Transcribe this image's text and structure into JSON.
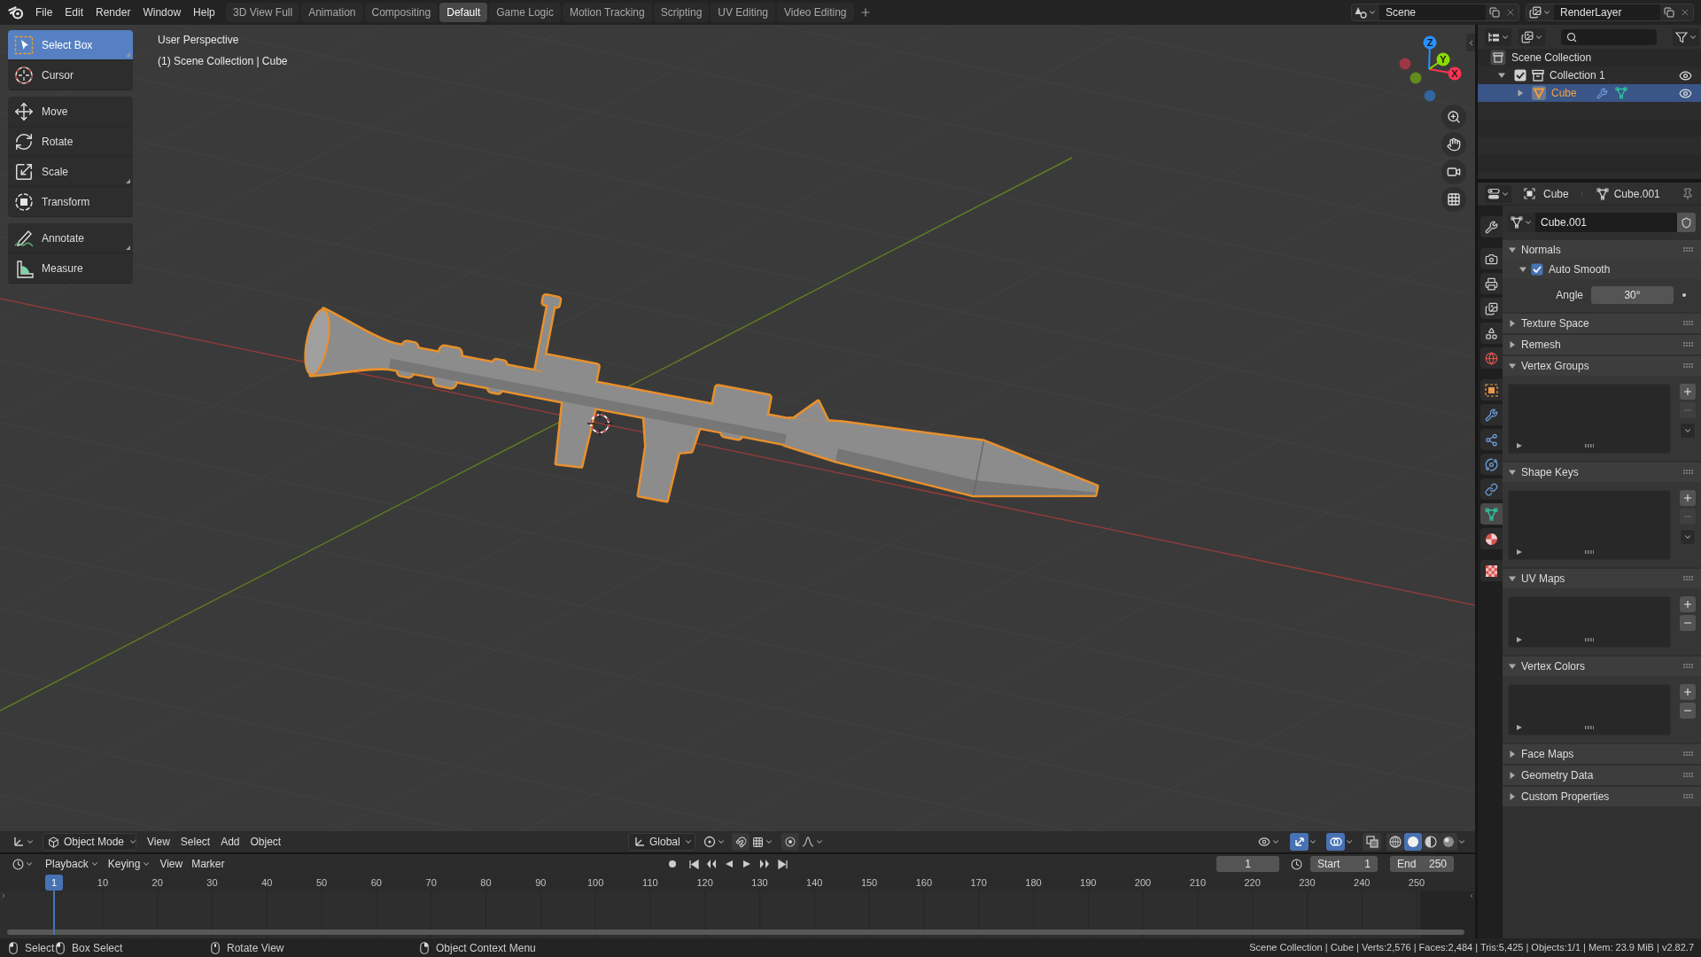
{
  "top_bar": {
    "menus": [
      "File",
      "Edit",
      "Render",
      "Window",
      "Help"
    ],
    "workspaces": [
      {
        "label": "3D View Full",
        "selected": false
      },
      {
        "label": "Animation",
        "selected": false
      },
      {
        "label": "Compositing",
        "selected": false
      },
      {
        "label": "Default",
        "selected": true
      },
      {
        "label": "Game Logic",
        "selected": false
      },
      {
        "label": "Motion Tracking",
        "selected": false
      },
      {
        "label": "Scripting",
        "selected": false
      },
      {
        "label": "UV Editing",
        "selected": false
      },
      {
        "label": "Video Editing",
        "selected": false
      }
    ],
    "scene": "Scene",
    "view_layer": "RenderLayer"
  },
  "toolbar": [
    [
      {
        "label": "Select Box",
        "selected": true,
        "flyout": true
      },
      {
        "label": "Cursor",
        "selected": false,
        "flyout": false
      }
    ],
    [
      {
        "label": "Move",
        "selected": false,
        "flyout": false
      },
      {
        "label": "Rotate",
        "selected": false,
        "flyout": false
      },
      {
        "label": "Scale",
        "selected": false,
        "flyout": true
      },
      {
        "label": "Transform",
        "selected": false,
        "flyout": false
      }
    ],
    [
      {
        "label": "Annotate",
        "selected": false,
        "flyout": true
      },
      {
        "label": "Measure",
        "selected": false,
        "flyout": false
      }
    ]
  ],
  "viewport": {
    "info": [
      "User Perspective",
      "(1) Scene Collection | Cube"
    ],
    "axes": [
      {
        "label": "X",
        "color": "#ff3352"
      },
      {
        "label": "Y",
        "color": "#8bdc00"
      },
      {
        "label": "Z",
        "color": "#2890ff"
      }
    ],
    "header": {
      "mode": "Object Mode",
      "menus": [
        "View",
        "Select",
        "Add",
        "Object"
      ],
      "orientation": "Global",
      "gizmos": true,
      "overlays": true,
      "xray": false,
      "shading": [
        {
          "selected": false
        },
        {
          "selected": true
        },
        {
          "selected": false
        },
        {
          "selected": false
        }
      ]
    }
  },
  "timeline": {
    "menus": [
      {
        "label": "Playback",
        "dropdown": true
      },
      {
        "label": "Keying",
        "dropdown": true
      },
      {
        "label": "View",
        "dropdown": false
      },
      {
        "label": "Marker",
        "dropdown": false
      }
    ],
    "current_frame": "1",
    "start": {
      "label": "Start",
      "value": "1"
    },
    "end": {
      "label": "End",
      "value": "250"
    },
    "playhead": "1",
    "ruler": [
      "10",
      "20",
      "30",
      "40",
      "50",
      "60",
      "70",
      "80",
      "90",
      "100",
      "110",
      "120",
      "130",
      "140",
      "150",
      "160",
      "170",
      "180",
      "190",
      "200",
      "210",
      "220",
      "230",
      "240",
      "250"
    ]
  },
  "outliner": {
    "tree": [
      {
        "kind": "scene_collection",
        "label": "Scene Collection",
        "selected": false,
        "children": [
          {
            "kind": "collection",
            "label": "Collection 1",
            "selected": false,
            "expanded": true,
            "checked": true,
            "visible": true,
            "children": [
              {
                "kind": "object",
                "label": "Cube",
                "selected": true,
                "expanded": false,
                "visible": true
              }
            ]
          }
        ]
      }
    ]
  },
  "properties": {
    "breadcrumb": [
      "Cube",
      "Cube.001"
    ],
    "tabs": [
      [
        {
          "selected": false
        }
      ],
      [
        {
          "selected": false
        },
        {
          "selected": false
        },
        {
          "selected": false
        },
        {
          "selected": false
        },
        {
          "selected": false
        }
      ],
      [
        {
          "selected": false
        },
        {
          "selected": false
        },
        {
          "selected": false
        },
        {
          "selected": false
        },
        {
          "selected": false
        },
        {
          "selected": true
        },
        {
          "selected": false
        }
      ],
      [
        {
          "selected": false
        }
      ]
    ],
    "mesh_name": "Cube.001",
    "panels": [
      {
        "kind": "normals",
        "title": "Normals",
        "expanded": true,
        "auto_smooth": {
          "label": "Auto Smooth",
          "checked": true,
          "expanded": true
        },
        "angle": {
          "label": "Angle",
          "value": "30°"
        }
      },
      {
        "kind": "plain",
        "title": "Texture Space",
        "expanded": false
      },
      {
        "kind": "plain",
        "title": "Remesh",
        "expanded": false
      },
      {
        "kind": "list",
        "title": "Vertex Groups",
        "expanded": true,
        "remove_disabled": true,
        "menu": true
      },
      {
        "kind": "list",
        "title": "Shape Keys",
        "expanded": true,
        "remove_disabled": true,
        "menu": true
      },
      {
        "kind": "list",
        "title": "UV Maps",
        "expanded": true,
        "remove_disabled": false,
        "menu": false
      },
      {
        "kind": "list",
        "title": "Vertex Colors",
        "expanded": true,
        "remove_disabled": false,
        "menu": false
      },
      {
        "kind": "plain",
        "title": "Face Maps",
        "expanded": false
      },
      {
        "kind": "plain",
        "title": "Geometry Data",
        "expanded": false
      },
      {
        "kind": "plain",
        "title": "Custom Properties",
        "expanded": false
      }
    ]
  },
  "status_bar": {
    "hints": [
      "Select",
      "Box Select",
      "Rotate View",
      "Object Context Menu"
    ],
    "stats": "Scene Collection | Cube | Verts:2,576 | Faces:2,484 | Tris:5,425 | Objects:1/1 | Mem: 23.9 MiB | v2.82.7"
  }
}
